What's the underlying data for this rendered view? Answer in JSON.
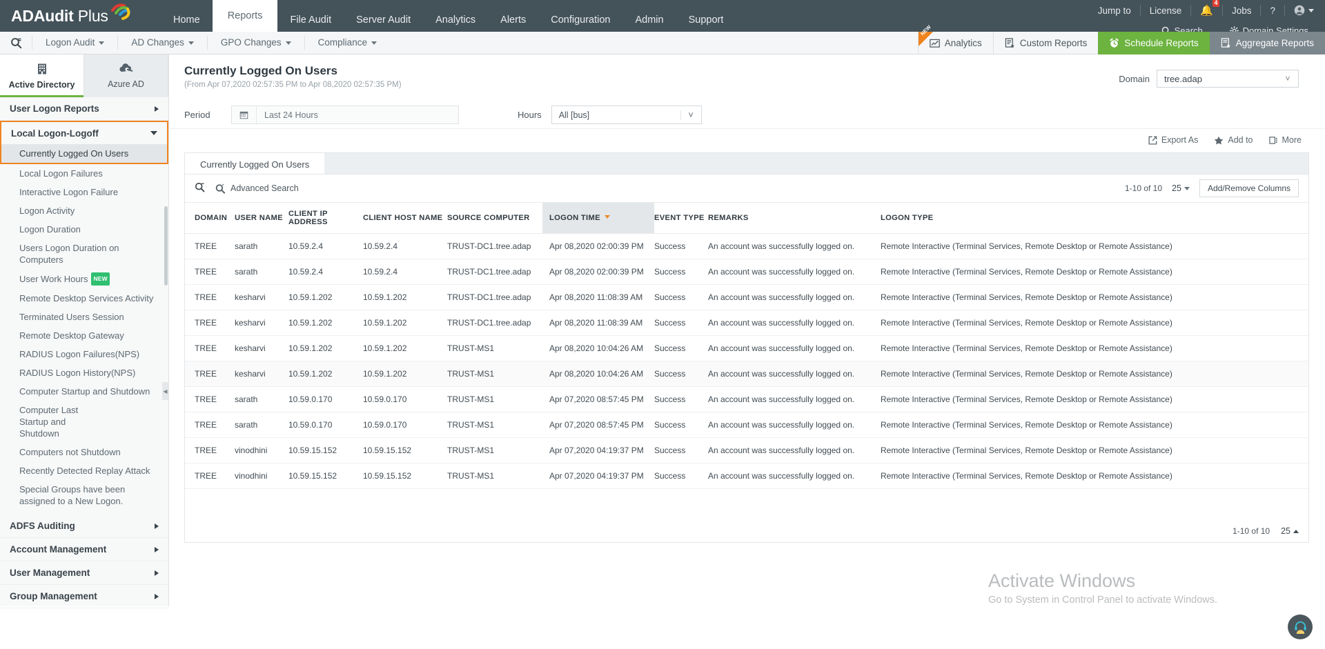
{
  "app": {
    "logo_text": "ADAudit",
    "logo_text2": "Plus"
  },
  "topnav": {
    "items": [
      {
        "label": "Home",
        "active": false
      },
      {
        "label": "Reports",
        "active": true
      },
      {
        "label": "File Audit",
        "active": false
      },
      {
        "label": "Server Audit",
        "active": false
      },
      {
        "label": "Analytics",
        "active": false
      },
      {
        "label": "Alerts",
        "active": false
      },
      {
        "label": "Configuration",
        "active": false
      },
      {
        "label": "Admin",
        "active": false
      },
      {
        "label": "Support",
        "active": false
      }
    ],
    "right": {
      "jump_to": "Jump to",
      "license": "License",
      "bell_icon": "bell-icon",
      "bell_count": "4",
      "jobs": "Jobs",
      "help": "?",
      "user_icon": "user-account-icon"
    },
    "subright": {
      "search": "Search...",
      "domain_settings": "Domain Settings"
    }
  },
  "secondnav": {
    "search_icon": "search-reports-icon",
    "items": [
      {
        "label": "Logon Audit"
      },
      {
        "label": "AD Changes"
      },
      {
        "label": "GPO Changes"
      },
      {
        "label": "Compliance"
      }
    ],
    "right_buttons": [
      {
        "label": "Analytics",
        "icon": "analytics-icon",
        "badge": "NEW",
        "style": "plain"
      },
      {
        "label": "Custom Reports",
        "icon": "custom-reports-icon",
        "style": "plain"
      },
      {
        "label": "Schedule Reports",
        "icon": "alarm-clock-icon",
        "style": "green"
      },
      {
        "label": "Aggregate Reports",
        "icon": "aggregate-reports-icon",
        "style": "grey"
      }
    ]
  },
  "sidebar": {
    "tabs": [
      {
        "label": "Active Directory",
        "icon": "building-icon",
        "active": true
      },
      {
        "label": "Azure AD",
        "icon": "cloud-icon",
        "active": false
      }
    ],
    "groups": [
      {
        "label": "User Logon Reports",
        "expanded": false,
        "highlight": false,
        "items": []
      },
      {
        "label": "Local Logon-Logoff",
        "expanded": true,
        "highlight": true,
        "items": [
          {
            "label": "Currently Logged On Users",
            "selected": true
          },
          {
            "label": "Local Logon Failures",
            "selected": false
          },
          {
            "label": "Interactive Logon Failure",
            "selected": false
          },
          {
            "label": "Logon Activity",
            "selected": false
          },
          {
            "label": "Logon Duration",
            "selected": false
          },
          {
            "label": "Users Logon Duration on Computers",
            "selected": false
          },
          {
            "label": "User Work Hours",
            "selected": false,
            "tag": "NEW"
          },
          {
            "label": "Remote Desktop Services Activity",
            "selected": false
          },
          {
            "label": "Terminated Users Session",
            "selected": false
          },
          {
            "label": "Remote Desktop Gateway",
            "selected": false
          },
          {
            "label": "RADIUS Logon Failures(NPS)",
            "selected": false
          },
          {
            "label": "RADIUS Logon History(NPS)",
            "selected": false
          },
          {
            "label": "Computer Startup and Shutdown",
            "selected": false
          },
          {
            "label": "Computer Last Startup and Shutdown",
            "selected": false
          },
          {
            "label": "Computers not Shutdown",
            "selected": false
          },
          {
            "label": "Recently Detected Replay Attack",
            "selected": false
          },
          {
            "label": "Special Groups have been assigned to a New Logon.",
            "selected": false
          }
        ]
      },
      {
        "label": "ADFS Auditing",
        "expanded": false,
        "highlight": false,
        "items": []
      },
      {
        "label": "Account Management",
        "expanded": false,
        "highlight": false,
        "items": []
      },
      {
        "label": "User Management",
        "expanded": false,
        "highlight": false,
        "items": []
      },
      {
        "label": "Group Management",
        "expanded": false,
        "highlight": false,
        "items": []
      }
    ]
  },
  "page": {
    "title": "Currently Logged On Users",
    "subtitle": "(From Apr 07,2020 02:57:35 PM to Apr 08,2020 02:57:35 PM)",
    "domain_label": "Domain",
    "domain_value": "tree.adap",
    "period_label": "Period",
    "period_value": "Last 24 Hours",
    "hours_label": "Hours",
    "hours_value": "All [bus]",
    "actions": [
      {
        "label": "Export As",
        "icon": "export-icon"
      },
      {
        "label": "Add to",
        "icon": "star-icon"
      },
      {
        "label": "More",
        "icon": "more-icon"
      }
    ],
    "tab_label": "Currently Logged On Users"
  },
  "table": {
    "search_icon": "table-search-icon",
    "advanced_search": "Advanced Search",
    "range_top": "1-10 of 10",
    "page_size_top": "25",
    "add_remove_columns": "Add/Remove Columns",
    "range_bottom": "1-10 of 10",
    "page_size_bottom": "25",
    "columns": [
      "DOMAIN",
      "USER NAME",
      "CLIENT IP ADDRESS",
      "CLIENT HOST NAME",
      "SOURCE COMPUTER",
      "LOGON TIME",
      "EVENT TYPE",
      "REMARKS",
      "LOGON TYPE"
    ],
    "sorted_column": "LOGON TIME",
    "sort_direction": "desc",
    "rows": [
      [
        "TREE",
        "sarath",
        "10.59.2.4",
        "10.59.2.4",
        "TRUST-DC1.tree.adap",
        "Apr 08,2020 02:00:39 PM",
        "Success",
        "An account was successfully logged on.",
        "Remote Interactive (Terminal Services, Remote Desktop or Remote Assistance)"
      ],
      [
        "TREE",
        "sarath",
        "10.59.2.4",
        "10.59.2.4",
        "TRUST-DC1.tree.adap",
        "Apr 08,2020 02:00:39 PM",
        "Success",
        "An account was successfully logged on.",
        "Remote Interactive (Terminal Services, Remote Desktop or Remote Assistance)"
      ],
      [
        "TREE",
        "kesharvi",
        "10.59.1.202",
        "10.59.1.202",
        "TRUST-DC1.tree.adap",
        "Apr 08,2020 11:08:39 AM",
        "Success",
        "An account was successfully logged on.",
        "Remote Interactive (Terminal Services, Remote Desktop or Remote Assistance)"
      ],
      [
        "TREE",
        "kesharvi",
        "10.59.1.202",
        "10.59.1.202",
        "TRUST-DC1.tree.adap",
        "Apr 08,2020 11:08:39 AM",
        "Success",
        "An account was successfully logged on.",
        "Remote Interactive (Terminal Services, Remote Desktop or Remote Assistance)"
      ],
      [
        "TREE",
        "kesharvi",
        "10.59.1.202",
        "10.59.1.202",
        "TRUST-MS1",
        "Apr 08,2020 10:04:26 AM",
        "Success",
        "An account was successfully logged on.",
        "Remote Interactive (Terminal Services, Remote Desktop or Remote Assistance)"
      ],
      [
        "TREE",
        "kesharvi",
        "10.59.1.202",
        "10.59.1.202",
        "TRUST-MS1",
        "Apr 08,2020 10:04:26 AM",
        "Success",
        "An account was successfully logged on.",
        "Remote Interactive (Terminal Services, Remote Desktop or Remote Assistance)"
      ],
      [
        "TREE",
        "sarath",
        "10.59.0.170",
        "10.59.0.170",
        "TRUST-MS1",
        "Apr 07,2020 08:57:45 PM",
        "Success",
        "An account was successfully logged on.",
        "Remote Interactive (Terminal Services, Remote Desktop or Remote Assistance)"
      ],
      [
        "TREE",
        "sarath",
        "10.59.0.170",
        "10.59.0.170",
        "TRUST-MS1",
        "Apr 07,2020 08:57:45 PM",
        "Success",
        "An account was successfully logged on.",
        "Remote Interactive (Terminal Services, Remote Desktop or Remote Assistance)"
      ],
      [
        "TREE",
        "vinodhini",
        "10.59.15.152",
        "10.59.15.152",
        "TRUST-MS1",
        "Apr 07,2020 04:19:37 PM",
        "Success",
        "An account was successfully logged on.",
        "Remote Interactive (Terminal Services, Remote Desktop or Remote Assistance)"
      ],
      [
        "TREE",
        "vinodhini",
        "10.59.15.152",
        "10.59.15.152",
        "TRUST-MS1",
        "Apr 07,2020 04:19:37 PM",
        "Success",
        "An account was successfully logged on.",
        "Remote Interactive (Terminal Services, Remote Desktop or Remote Assistance)"
      ]
    ]
  },
  "watermark": {
    "title": "Activate Windows",
    "subtitle": "Go to System in Control Panel to activate Windows."
  },
  "colors": {
    "topbar": "#44525a",
    "accent_green": "#6cb33f",
    "accent_orange": "#f0831e",
    "badge_red": "#e03c31"
  }
}
